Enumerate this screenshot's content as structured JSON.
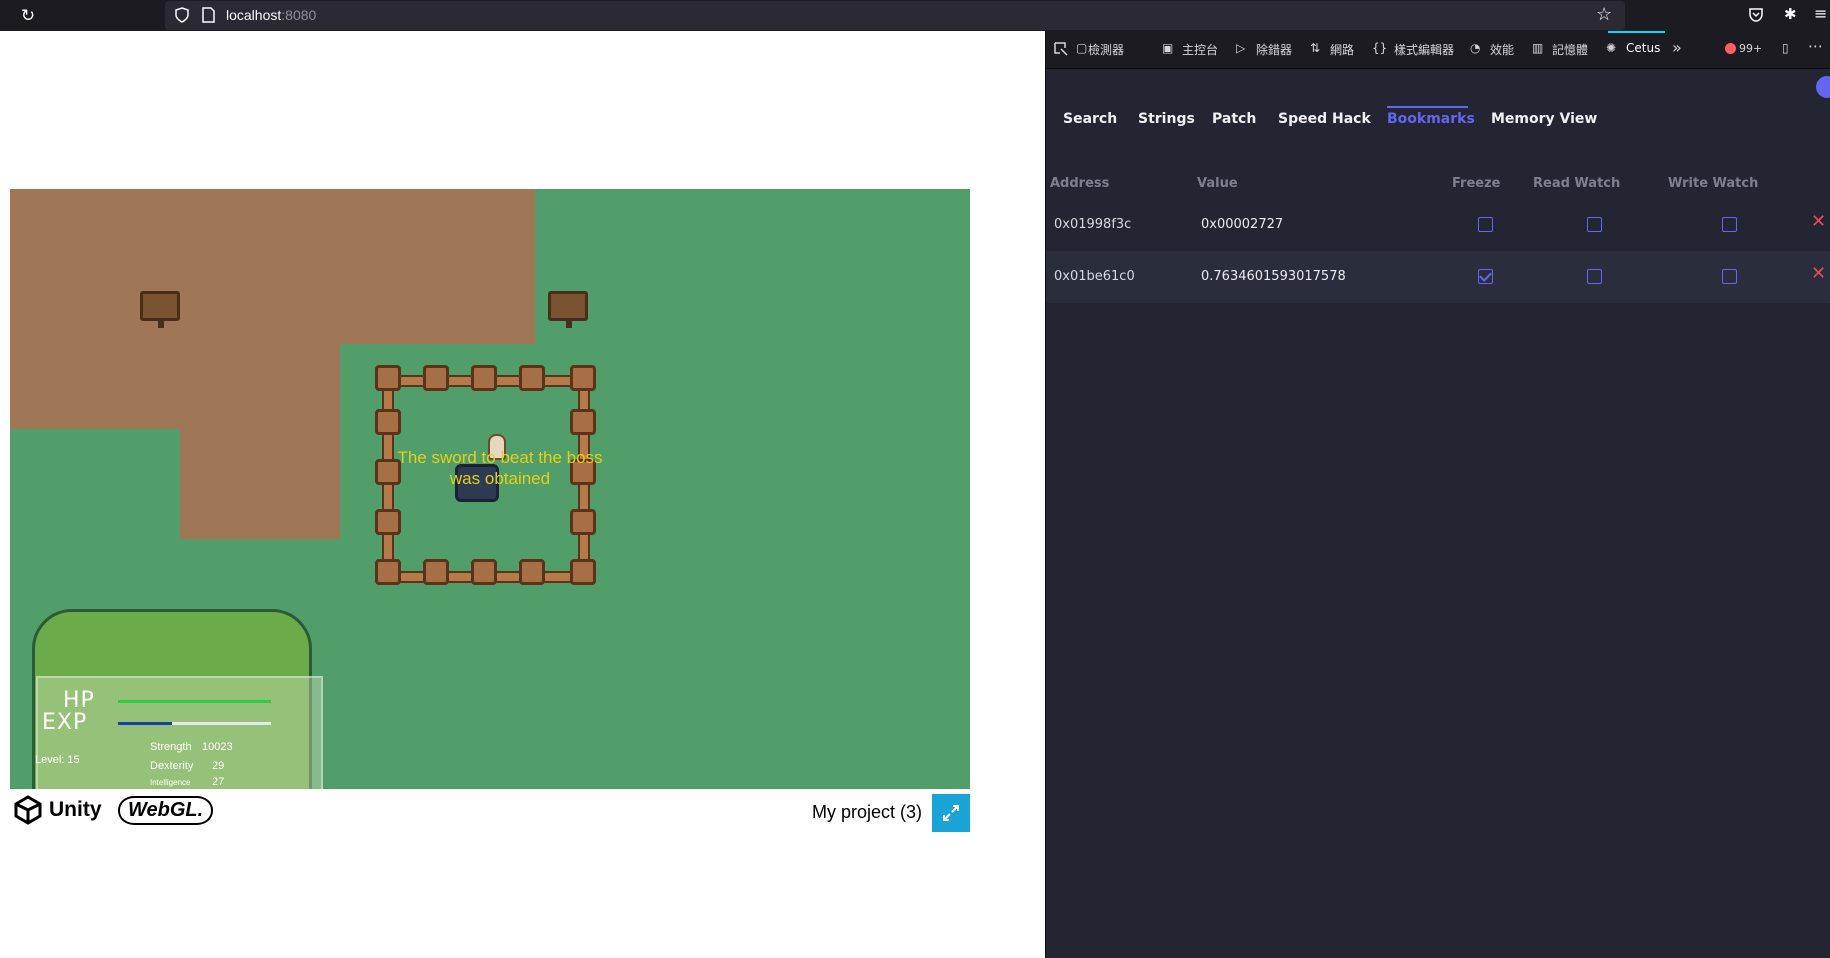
{
  "browser": {
    "url_host": "localhost",
    "url_port": ":8080"
  },
  "game": {
    "message_line1": "The sword to beat the boss",
    "message_line2": "was obtained",
    "hud": {
      "hp_label": "HP",
      "exp_label": "EXP",
      "level_label": "Level:  15",
      "strength_label": "Strength",
      "strength_value": "10023",
      "dexterity_label": "Dexterity",
      "dexterity_value": "29",
      "intelligence_label": "Intelligence",
      "intelligence_value": "27",
      "hp_fill": 1.0,
      "exp_fill": 0.35
    }
  },
  "unity_footer": {
    "unity_label": "Unity",
    "webgl_label": "WebGL.",
    "project_title": "My project (3)"
  },
  "devtools": {
    "tabs": [
      "檢測器",
      "主控台",
      "除錯器",
      "網路",
      "樣式編輯器",
      "效能",
      "記憶體",
      "Cetus"
    ],
    "active_tab": "Cetus",
    "error_count": "99+"
  },
  "cetus": {
    "tabs": [
      "Search",
      "Strings",
      "Patch",
      "Speed Hack",
      "Bookmarks",
      "Memory View"
    ],
    "active_tab": "Bookmarks",
    "columns": {
      "address": "Address",
      "value": "Value",
      "freeze": "Freeze",
      "read_watch": "Read Watch",
      "write_watch": "Write Watch"
    },
    "bookmarks": [
      {
        "address": "0x01998f3c",
        "value": "0x00002727",
        "freeze": false,
        "read_watch": false,
        "write_watch": false
      },
      {
        "address": "0x01be61c0",
        "value": "0.7634601593017578",
        "freeze": true,
        "read_watch": false,
        "write_watch": false
      }
    ],
    "accent_color": "#6366f1"
  }
}
